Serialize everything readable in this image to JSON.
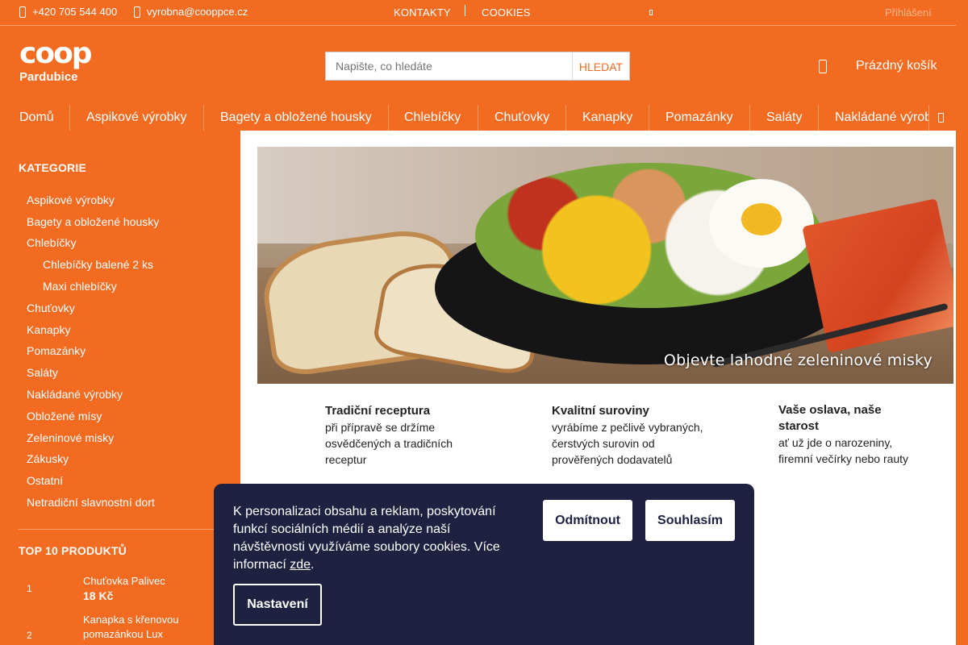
{
  "topbar": {
    "phone": "+420 705 544 400",
    "email": "vyrobna@cooppce.cz",
    "contacts": "KONTAKTY",
    "cookies": "COOKIES",
    "login": "Přihlášení"
  },
  "header": {
    "logo_top": "coop",
    "logo_bottom": "Pardubice",
    "search_placeholder": "Napište, co hledáte",
    "search_button": "HLEDAT",
    "cart": "Prázdný košík"
  },
  "nav": [
    "Domů",
    "Aspikové výrobky",
    "Bagety a obložené housky",
    "Chlebíčky",
    "Chuťovky",
    "Kanapky",
    "Pomazánky",
    "Saláty",
    "Nakládané výrobky"
  ],
  "sidebar": {
    "categories_title": "KATEGORIE",
    "categories": [
      "Aspikové výrobky",
      "Bagety a obložené housky",
      "Chlebíčky",
      "Chlebíčky balené 2 ks",
      "Maxi chlebíčky",
      "Chuťovky",
      "Kanapky",
      "Pomazánky",
      "Saláty",
      "Nakládané výrobky",
      "Obložené mísy",
      "Zeleninové misky",
      "Zákusky",
      "Ostatní",
      "Netradiční slavnostní dort"
    ],
    "top_title": "TOP 10 PRODUKTŮ",
    "top_items": [
      {
        "rank": "1",
        "name": "Chuťovka Palivec",
        "price": "18 Kč"
      },
      {
        "rank": "2",
        "name": "Kanapka s křenovou pomazánkou Lux",
        "price": ""
      }
    ]
  },
  "banner": {
    "caption": "Objevte lahodné zeleninové misky"
  },
  "features": [
    {
      "title": "Tradiční receptura",
      "text": "při přípravě se držíme osvědčených a tradičních receptur"
    },
    {
      "title": "Kvalitní suroviny",
      "text": "vyrábíme z pečlivě vybraných, čerstvých surovin od prověřených dodavatelů"
    },
    {
      "title": "Vaše oslava, naše starost",
      "text": "ať už jde o narozeniny, firemní večírky nebo rauty"
    }
  ],
  "cookie": {
    "text": "K personalizaci obsahu a reklam, poskytování funkcí sociálních médií a analýze naší návštěvnosti využíváme soubory cookies. Více informací",
    "link": "zde",
    "after_link": ".",
    "decline": "Odmítnout",
    "accept": "Souhlasím",
    "settings": "Nastavení"
  },
  "colors": {
    "brand": "#f26b21",
    "cookie_bg": "#1e2140"
  }
}
